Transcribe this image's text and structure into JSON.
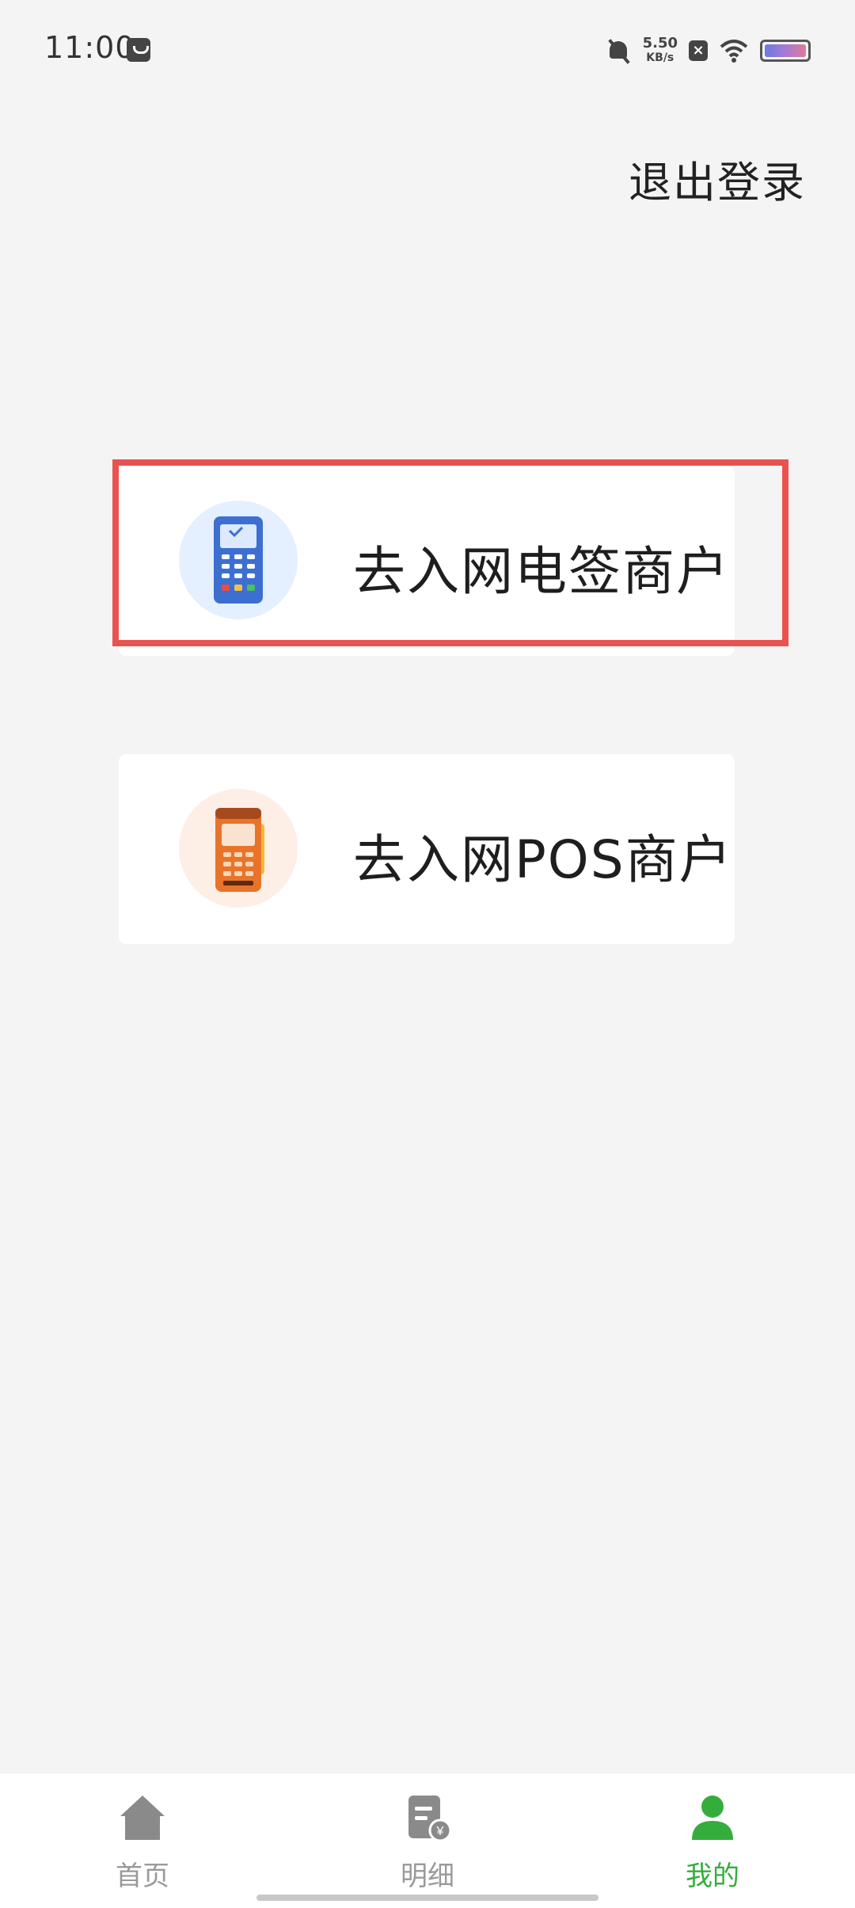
{
  "status_bar": {
    "time": "11:00",
    "net_speed_value": "5.50",
    "net_speed_unit": "KB/s",
    "icons": [
      "bag-icon",
      "bell-off-icon",
      "close-icon",
      "wifi-icon",
      "battery-icon"
    ]
  },
  "header": {
    "logout_label": "退出登录"
  },
  "cards": [
    {
      "label": "去入网电签商户",
      "icon": "payment-terminal-blue-icon",
      "accent": "#e4f0ff"
    },
    {
      "label": "去入网POS商户",
      "icon": "pos-terminal-orange-icon",
      "accent": "#fdeee6"
    }
  ],
  "highlight_color": "#e9534f",
  "bottom_nav": {
    "items": [
      {
        "label": "首页",
        "icon": "home-icon",
        "active": false
      },
      {
        "label": "明细",
        "icon": "bill-detail-icon",
        "active": false
      },
      {
        "label": "我的",
        "icon": "user-icon",
        "active": true
      }
    ],
    "active_color": "#35ad3c",
    "inactive_color": "#9a9a9a"
  }
}
